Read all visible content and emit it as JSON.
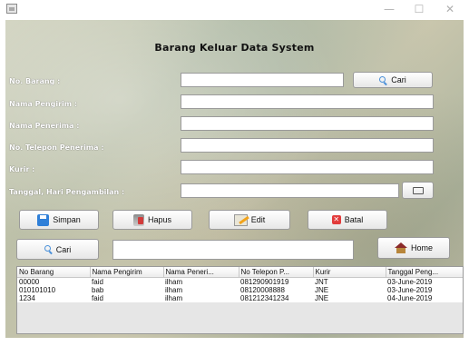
{
  "window": {
    "title": "",
    "minimize": "—",
    "maximize": "☐",
    "close": "✕"
  },
  "header": {
    "title": "Barang Keluar Data System"
  },
  "form": {
    "labels": {
      "no_barang": "No. Barang   :",
      "nama_pengirim": "Nama Pengirim  :",
      "nama_penerima": "Nama Penerima  :",
      "no_telepon": "No. Telepon Penerima  :",
      "kurir": "Kurir  :",
      "tanggal": "Tanggal, Hari Pengambilan  :"
    },
    "values": {
      "no_barang": "",
      "nama_pengirim": "",
      "nama_penerima": "",
      "no_telepon": "",
      "kurir": "",
      "tanggal": ""
    }
  },
  "buttons": {
    "cari_top": "Cari",
    "simpan": "Simpan",
    "hapus": "Hapus",
    "edit": "Edit",
    "batal": "Batal",
    "cari_bottom": "Cari",
    "home": "Home"
  },
  "search": {
    "value": ""
  },
  "table": {
    "columns": [
      "No Barang",
      "Nama Pengirim",
      "Nama Peneri...",
      "No Telepon P...",
      "Kurir",
      "Tanggal Peng..."
    ],
    "rows": [
      [
        "00000",
        "faid",
        "ilham",
        "081290901919",
        "JNT",
        "03-June-2019"
      ],
      [
        "010101010",
        "bab",
        "ilham",
        "08120008888",
        "JNE",
        "03-June-2019"
      ],
      [
        "1234",
        "faid",
        "ilham",
        "081212341234",
        "JNE",
        "04-June-2019"
      ]
    ]
  },
  "colors": {
    "accent": "#4a90d9",
    "batal_icon": "#e23b3b",
    "field_border": "#9a9a9a"
  },
  "icons": {
    "cari": "search-icon",
    "simpan": "save-icon",
    "hapus": "delete-icon",
    "edit": "edit-icon",
    "batal": "cancel-icon",
    "home": "home-icon",
    "tanggal": "calendar-icon"
  }
}
